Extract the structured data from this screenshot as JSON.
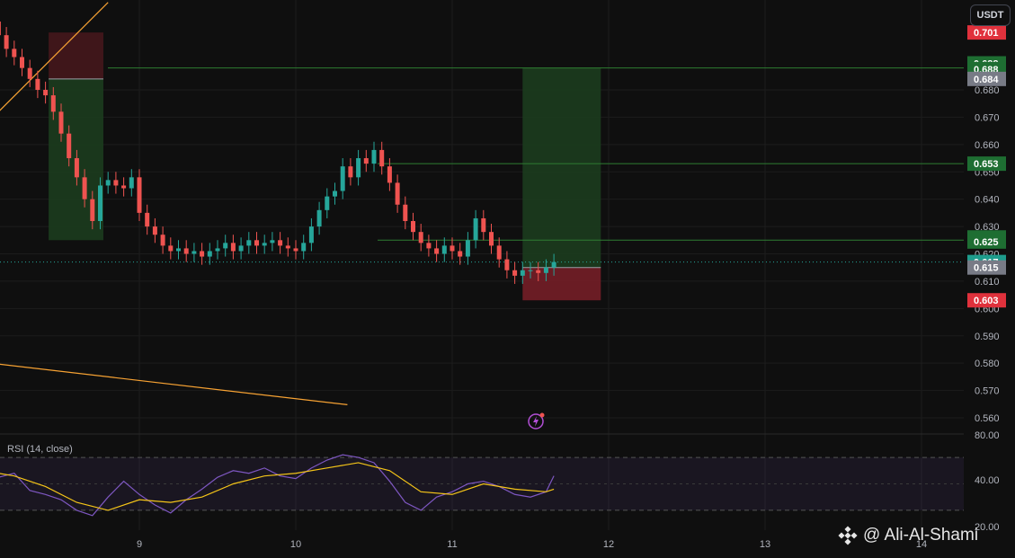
{
  "currency_button": "USDT",
  "watermark": {
    "text": "@ Ali-Al-Shami",
    "logo_icon": "binance-diamond-logo"
  },
  "colors": {
    "up": "#26a69a",
    "down": "#ef5350",
    "target_zone": "#1b3a1e",
    "stop_zone": "#7a1f28",
    "rsi_line": "#7e57c2",
    "rsi_ma": "#f5c518",
    "trendline": "#f7a233",
    "current_price": "#26a69a"
  },
  "chart_data": {
    "type": "candlestick",
    "price_axis": {
      "ylim": [
        0.555,
        0.705
      ],
      "ticks": [
        "0.680",
        "0.670",
        "0.660",
        "0.650",
        "0.640",
        "0.630",
        "0.620",
        "0.610",
        "0.600",
        "0.590",
        "0.580",
        "0.570",
        "0.560"
      ]
    },
    "time_axis": {
      "ticks": [
        "9",
        "10",
        "11",
        "12",
        "13",
        "14"
      ]
    },
    "price_badges": [
      {
        "label": "0.701",
        "value": 0.701,
        "color": "#e0313c"
      },
      {
        "label": "0.688",
        "value": 0.6897,
        "color": "#1e6e32"
      },
      {
        "label": "0.688",
        "value": 0.6876,
        "color": "#1e6e32"
      },
      {
        "label": "0.684",
        "value": 0.684,
        "color": "#787b86"
      },
      {
        "label": "0.653",
        "value": 0.653,
        "color": "#1e6e32"
      },
      {
        "label": "0.626",
        "value": 0.626,
        "color": "#1e6e32"
      },
      {
        "label": "0.625",
        "value": 0.6245,
        "color": "#1e6e32"
      },
      {
        "label": "0.617",
        "value": 0.617,
        "color": "#1e9c8c"
      },
      {
        "label": "0.615",
        "value": 0.615,
        "color": "#787b86"
      },
      {
        "label": "0.603",
        "value": 0.603,
        "color": "#e0313c"
      }
    ],
    "horizontal_lines": [
      0.688,
      0.653,
      0.625
    ],
    "current_price": 0.617,
    "positions": [
      {
        "type": "long",
        "x_start": 8.42,
        "x_end": 8.77,
        "entry": 0.684,
        "stop": 0.701,
        "target": 0.625
      },
      {
        "type": "long",
        "x_start": 11.45,
        "x_end": 11.95,
        "entry": 0.615,
        "stop": 0.603,
        "target": 0.688
      }
    ],
    "trendlines": [
      {
        "x1": 7.75,
        "y1": 0.652,
        "x2": 8.8,
        "y2": 0.712
      },
      {
        "x1": 7.75,
        "y1": 0.582,
        "x2": 10.33,
        "y2": 0.5648
      }
    ],
    "candles_close": [
      [
        8.0,
        0.712
      ],
      [
        8.05,
        0.705
      ],
      [
        8.1,
        0.7
      ],
      [
        8.15,
        0.695
      ],
      [
        8.2,
        0.692
      ],
      [
        8.25,
        0.688
      ],
      [
        8.3,
        0.684
      ],
      [
        8.35,
        0.68
      ],
      [
        8.4,
        0.678
      ],
      [
        8.45,
        0.672
      ],
      [
        8.5,
        0.664
      ],
      [
        8.55,
        0.655
      ],
      [
        8.6,
        0.648
      ],
      [
        8.65,
        0.64
      ],
      [
        8.7,
        0.632
      ],
      [
        8.75,
        0.645
      ],
      [
        8.8,
        0.647
      ],
      [
        8.85,
        0.645
      ],
      [
        8.9,
        0.644
      ],
      [
        8.95,
        0.648
      ],
      [
        9.0,
        0.635
      ],
      [
        9.05,
        0.63
      ],
      [
        9.1,
        0.627
      ],
      [
        9.15,
        0.623
      ],
      [
        9.2,
        0.621
      ],
      [
        9.25,
        0.622
      ],
      [
        9.3,
        0.62
      ],
      [
        9.35,
        0.621
      ],
      [
        9.4,
        0.619
      ],
      [
        9.45,
        0.621
      ],
      [
        9.5,
        0.622
      ],
      [
        9.55,
        0.624
      ],
      [
        9.6,
        0.621
      ],
      [
        9.65,
        0.623
      ],
      [
        9.7,
        0.625
      ],
      [
        9.75,
        0.623
      ],
      [
        9.8,
        0.624
      ],
      [
        9.85,
        0.625
      ],
      [
        9.9,
        0.623
      ],
      [
        9.95,
        0.622
      ],
      [
        10.0,
        0.621
      ],
      [
        10.05,
        0.624
      ],
      [
        10.1,
        0.63
      ],
      [
        10.15,
        0.636
      ],
      [
        10.2,
        0.641
      ],
      [
        10.25,
        0.643
      ],
      [
        10.3,
        0.652
      ],
      [
        10.35,
        0.648
      ],
      [
        10.4,
        0.655
      ],
      [
        10.45,
        0.653
      ],
      [
        10.5,
        0.658
      ],
      [
        10.55,
        0.652
      ],
      [
        10.6,
        0.646
      ],
      [
        10.65,
        0.638
      ],
      [
        10.7,
        0.632
      ],
      [
        10.75,
        0.628
      ],
      [
        10.8,
        0.624
      ],
      [
        10.85,
        0.622
      ],
      [
        10.9,
        0.62
      ],
      [
        10.95,
        0.623
      ],
      [
        11.0,
        0.621
      ],
      [
        11.05,
        0.619
      ],
      [
        11.1,
        0.625
      ],
      [
        11.15,
        0.633
      ],
      [
        11.2,
        0.628
      ],
      [
        11.25,
        0.623
      ],
      [
        11.3,
        0.618
      ],
      [
        11.35,
        0.614
      ],
      [
        11.4,
        0.612
      ],
      [
        11.45,
        0.614
      ],
      [
        11.5,
        0.614
      ],
      [
        11.55,
        0.613
      ],
      [
        11.6,
        0.615
      ],
      [
        11.65,
        0.617
      ]
    ],
    "rsi": {
      "label": "RSI (14, close)",
      "ylim": [
        15,
        85
      ],
      "ticks": [
        "80.00",
        "40.00",
        "20.00"
      ],
      "bands": [
        70,
        30
      ],
      "values": [
        [
          8.0,
          62
        ],
        [
          8.1,
          55
        ],
        [
          8.2,
          58
        ],
        [
          8.3,
          45
        ],
        [
          8.4,
          42
        ],
        [
          8.5,
          38
        ],
        [
          8.6,
          30
        ],
        [
          8.7,
          26
        ],
        [
          8.8,
          40
        ],
        [
          8.9,
          52
        ],
        [
          9.0,
          42
        ],
        [
          9.1,
          34
        ],
        [
          9.2,
          28
        ],
        [
          9.3,
          38
        ],
        [
          9.4,
          46
        ],
        [
          9.5,
          55
        ],
        [
          9.6,
          60
        ],
        [
          9.7,
          58
        ],
        [
          9.8,
          62
        ],
        [
          9.9,
          56
        ],
        [
          10.0,
          54
        ],
        [
          10.1,
          62
        ],
        [
          10.2,
          68
        ],
        [
          10.3,
          72
        ],
        [
          10.4,
          70
        ],
        [
          10.5,
          66
        ],
        [
          10.6,
          52
        ],
        [
          10.7,
          36
        ],
        [
          10.8,
          30
        ],
        [
          10.9,
          40
        ],
        [
          11.0,
          44
        ],
        [
          11.1,
          50
        ],
        [
          11.2,
          52
        ],
        [
          11.3,
          48
        ],
        [
          11.4,
          42
        ],
        [
          11.5,
          40
        ],
        [
          11.6,
          44
        ],
        [
          11.65,
          56
        ]
      ],
      "ma_values": [
        [
          8.0,
          60
        ],
        [
          8.2,
          56
        ],
        [
          8.4,
          48
        ],
        [
          8.6,
          36
        ],
        [
          8.8,
          30
        ],
        [
          9.0,
          38
        ],
        [
          9.2,
          36
        ],
        [
          9.4,
          40
        ],
        [
          9.6,
          50
        ],
        [
          9.8,
          56
        ],
        [
          10.0,
          58
        ],
        [
          10.2,
          62
        ],
        [
          10.4,
          66
        ],
        [
          10.6,
          60
        ],
        [
          10.8,
          44
        ],
        [
          11.0,
          42
        ],
        [
          11.2,
          50
        ],
        [
          11.4,
          46
        ],
        [
          11.6,
          44
        ],
        [
          11.65,
          46
        ]
      ]
    }
  }
}
